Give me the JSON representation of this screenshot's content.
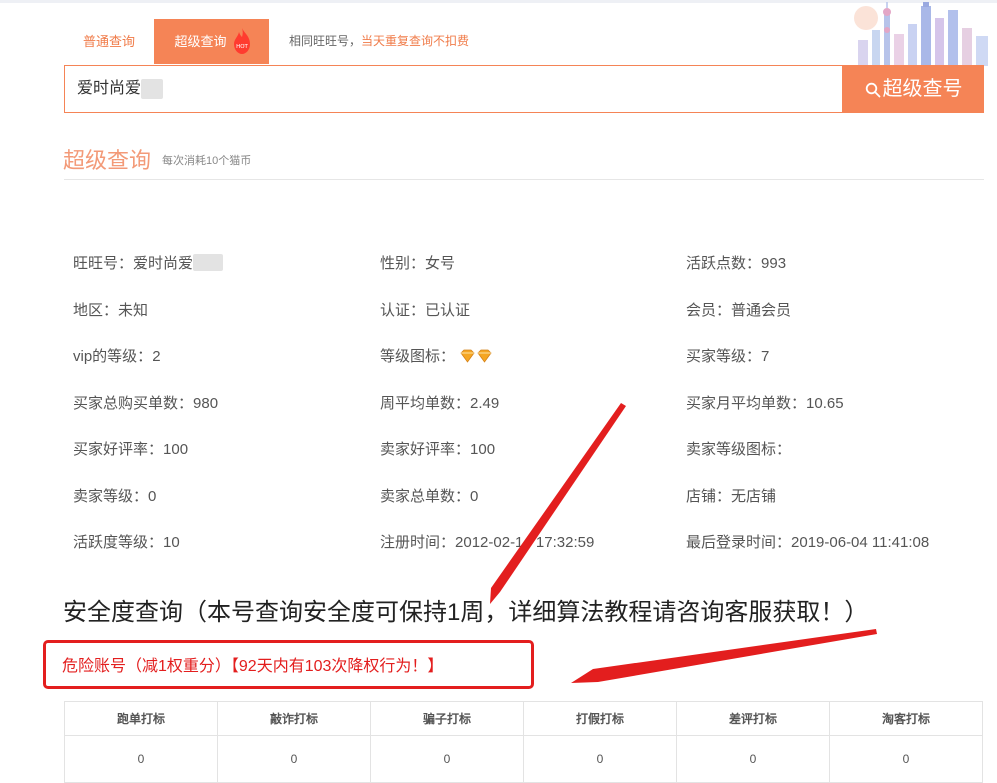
{
  "tabs": {
    "normal": "普通查询",
    "super": "超级查询",
    "hot_badge": "HOT",
    "note_prefix": "相同旺旺号，",
    "note_highlight": "当天重复查询不扣费"
  },
  "search": {
    "value": "爱时尚爱",
    "button": "超级查号"
  },
  "section": {
    "title": "超级查询",
    "subtitle": "每次消耗10个猫币"
  },
  "info": {
    "col1": [
      {
        "label": "旺旺号：",
        "value": "爱时尚爱"
      },
      {
        "label": "地区：",
        "value": "未知"
      },
      {
        "label": "vip的等级：",
        "value": "2"
      },
      {
        "label": "买家总购买单数：",
        "value": "980"
      },
      {
        "label": "买家好评率：",
        "value": "100"
      },
      {
        "label": "卖家等级：",
        "value": "0"
      },
      {
        "label": "活跃度等级：",
        "value": "10"
      }
    ],
    "col2": [
      {
        "label": "性别：",
        "value": "女号"
      },
      {
        "label": "认证：",
        "value": "已认证"
      },
      {
        "label": "等级图标：",
        "value": ""
      },
      {
        "label": "周平均单数：",
        "value": "2.49"
      },
      {
        "label": "卖家好评率：",
        "value": "100"
      },
      {
        "label": "卖家总单数：",
        "value": "0"
      },
      {
        "label": "注册时间：",
        "value": "2012-02-14 17:32:59"
      }
    ],
    "col3": [
      {
        "label": "活跃点数：",
        "value": "993"
      },
      {
        "label": "会员：",
        "value": "普通会员"
      },
      {
        "label": "买家等级：",
        "value": "7"
      },
      {
        "label": "买家月平均单数：",
        "value": "10.65"
      },
      {
        "label": "卖家等级图标：",
        "value": ""
      },
      {
        "label": "店铺：",
        "value": "无店铺"
      },
      {
        "label": "最后登录时间：",
        "value": "2019-06-04 11:41:08"
      }
    ]
  },
  "safety": {
    "title": "安全度查询（本号查询安全度可保持1周，详细算法教程请咨询客服获取！）",
    "danger": "危险账号（减1权重分）【92天内有103次降权行为！】"
  },
  "table": {
    "headers": [
      "跑单打标",
      "敲诈打标",
      "骗子打标",
      "打假打标",
      "差评打标",
      "淘客打标"
    ],
    "values": [
      "0",
      "0",
      "0",
      "0",
      "0",
      "0"
    ]
  },
  "colors": {
    "accent": "#f58456",
    "danger": "#e31e1e",
    "gem": "#f5a623"
  },
  "icons": {
    "search_button": "search-icon",
    "hot_badge": "flame-icon",
    "level_icon": "diamond-icon"
  }
}
